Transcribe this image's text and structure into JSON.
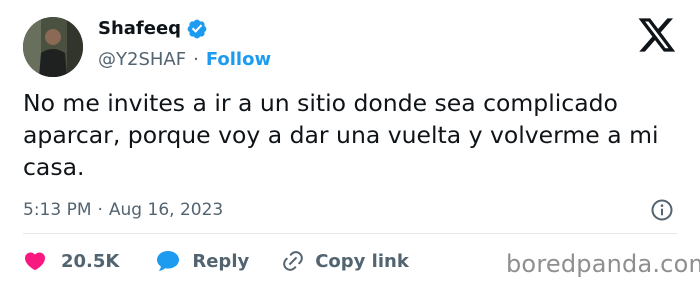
{
  "author": {
    "name": "Shafeeq",
    "handle": "@Y2SHAF",
    "separator": "·",
    "follow_label": "Follow",
    "verified_color": "#1d9bf0",
    "avatar_icon": "user-photo"
  },
  "platform_icon": "x-logo-icon",
  "tweet": {
    "text": "No me invites a ir a un sitio donde sea complicado aparcar, porque voy a dar una vuelta y volverme a mi casa.",
    "time": "5:13 PM",
    "separator": "·",
    "date": "Aug 16, 2023"
  },
  "actions": {
    "likes": "20.5K",
    "reply_label": "Reply",
    "copy_label": "Copy link",
    "like_color": "#f91880",
    "reply_color": "#1d9bf0"
  },
  "watermark": "boredpanda.com",
  "colors": {
    "text": "#0f1419",
    "secondary": "#536471",
    "accent": "#1d9bf0",
    "divider": "#e5e7ea",
    "watermark": "#8f8f8f"
  }
}
